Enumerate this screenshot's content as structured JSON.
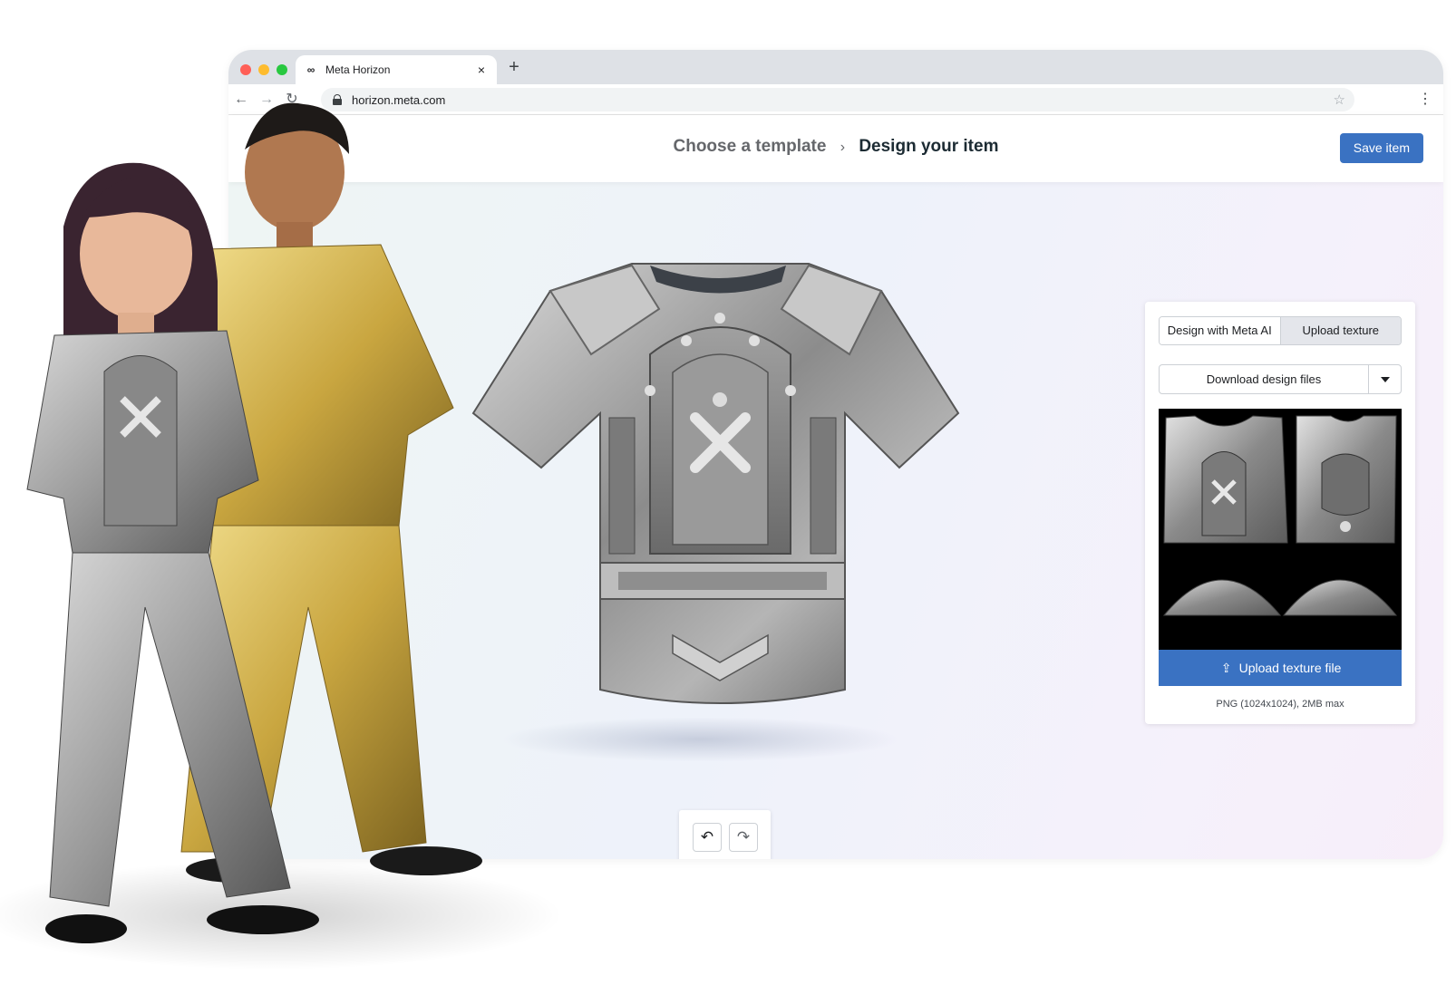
{
  "browser": {
    "tab_title": "Meta Horizon",
    "tab_close": "×",
    "new_tab": "+",
    "url": "horizon.meta.com",
    "back": "←",
    "forward": "→",
    "reload": "↻",
    "star": "☆",
    "menu": "⋮"
  },
  "header": {
    "close": "×",
    "step1": "Choose a template",
    "separator": "›",
    "step2": "Design your item",
    "save_label": "Save item"
  },
  "canvas": {
    "undo": "↶",
    "redo": "↷"
  },
  "panel": {
    "tab_ai": "Design with Meta AI",
    "tab_upload": "Upload texture",
    "download_label": "Download design files",
    "upload_label": "Upload texture file",
    "hint": "PNG (1024x1024), 2MB max"
  },
  "colors": {
    "accent": "#3a72c2",
    "text_primary": "#1c2b33",
    "text_secondary": "#65676b"
  }
}
